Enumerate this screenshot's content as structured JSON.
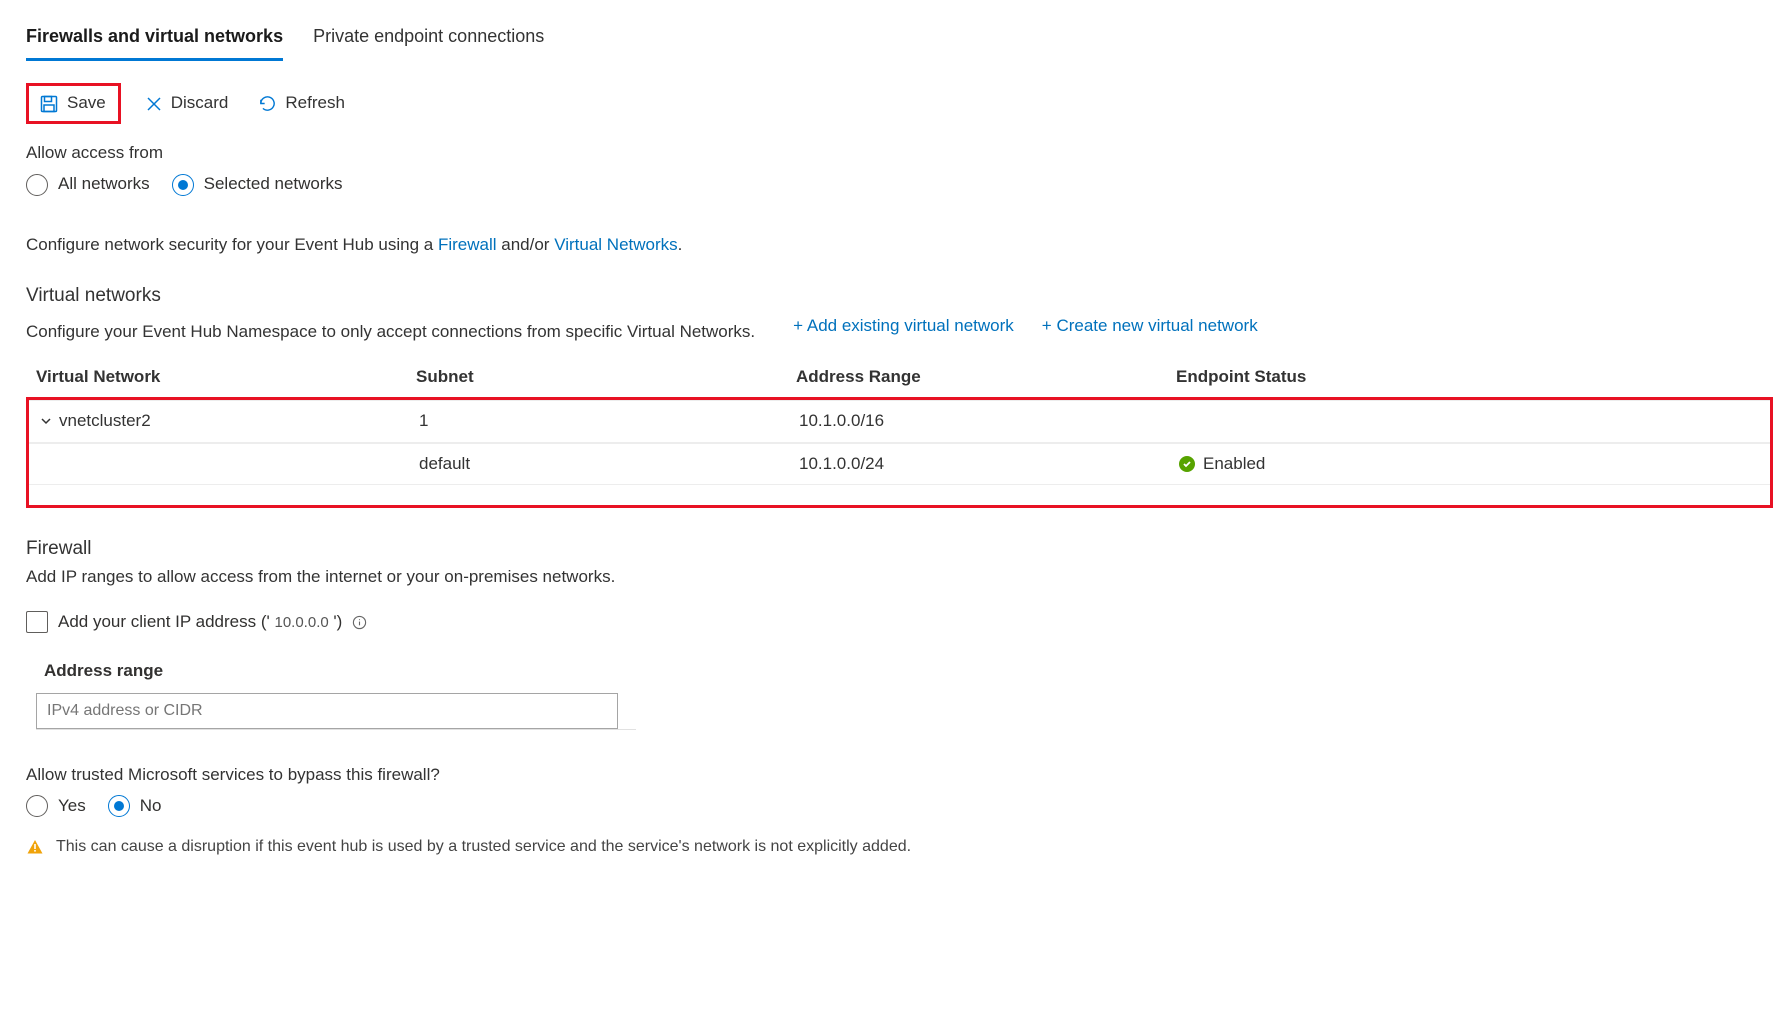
{
  "tabs": {
    "firewalls": "Firewalls and virtual networks",
    "endpoints": "Private endpoint connections"
  },
  "toolbar": {
    "save": "Save",
    "discard": "Discard",
    "refresh": "Refresh"
  },
  "access": {
    "label": "Allow access from",
    "all": "All networks",
    "selected": "Selected networks"
  },
  "configure": {
    "prefix": "Configure network security for your Event Hub using a ",
    "firewall": "Firewall",
    "andor": " and/or ",
    "vnets": "Virtual Networks",
    "suffix": "."
  },
  "vnet": {
    "heading": "Virtual networks",
    "desc": "Configure your Event Hub Namespace to only accept connections from specific Virtual Networks.",
    "add_existing": "+ Add existing virtual network",
    "create_new": "+ Create new virtual network",
    "columns": {
      "name": "Virtual Network",
      "subnet": "Subnet",
      "range": "Address Range",
      "status": "Endpoint Status"
    },
    "rows": [
      {
        "name": "vnetcluster2",
        "subnet": "1",
        "range": "10.1.0.0/16",
        "status": ""
      },
      {
        "name": "",
        "subnet": "default",
        "range": "10.1.0.0/24",
        "status": "Enabled"
      }
    ]
  },
  "firewall": {
    "heading": "Firewall",
    "desc": "Add IP ranges to allow access from the internet or your on-premises networks.",
    "client_ip_label_prefix": "Add your client IP address (' ",
    "client_ip_value": "10.0.0.0",
    "client_ip_label_suffix": " ')",
    "address_range_label": "Address range",
    "address_range_placeholder": "IPv4 address or CIDR"
  },
  "trusted": {
    "label": "Allow trusted Microsoft services to bypass this firewall?",
    "yes": "Yes",
    "no": "No",
    "warning": "This can cause a disruption if this event hub is used by a trusted service and the service's network is not explicitly added."
  }
}
